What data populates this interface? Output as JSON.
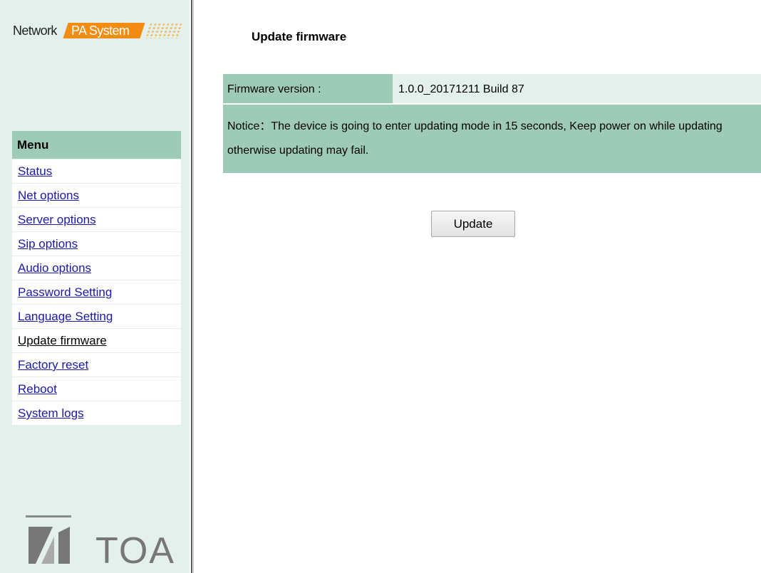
{
  "brand": {
    "network": "Network",
    "pa_system": "PA System",
    "orange": "#f28c12"
  },
  "sidebar": {
    "menu_header": "Menu",
    "items": [
      {
        "label": "Status",
        "active": false
      },
      {
        "label": "Net options",
        "active": false
      },
      {
        "label": "Server options",
        "active": false
      },
      {
        "label": "Sip options",
        "active": false
      },
      {
        "label": "Audio options",
        "active": false
      },
      {
        "label": "Password Setting",
        "active": false
      },
      {
        "label": "Language Setting",
        "active": false
      },
      {
        "label": "Update firmware",
        "active": true
      },
      {
        "label": "Factory reset",
        "active": false
      },
      {
        "label": "Reboot",
        "active": false
      },
      {
        "label": "System logs",
        "active": false
      }
    ],
    "logo": "TOA",
    "logo_icon": "toa-logo-icon"
  },
  "main": {
    "title": "Update firmware",
    "firmware_label": "Firmware version :",
    "firmware_value": "1.0.0_20171211 Build 87",
    "notice": "Notice：The device is going to enter updating mode in 15 seconds, Keep power on while updating otherwise updating may fail.",
    "update_button": "Update"
  },
  "colors": {
    "accent_green": "#9ecbb8",
    "light_green": "#e4f0ec",
    "link_blue": "#1a1aa6"
  }
}
